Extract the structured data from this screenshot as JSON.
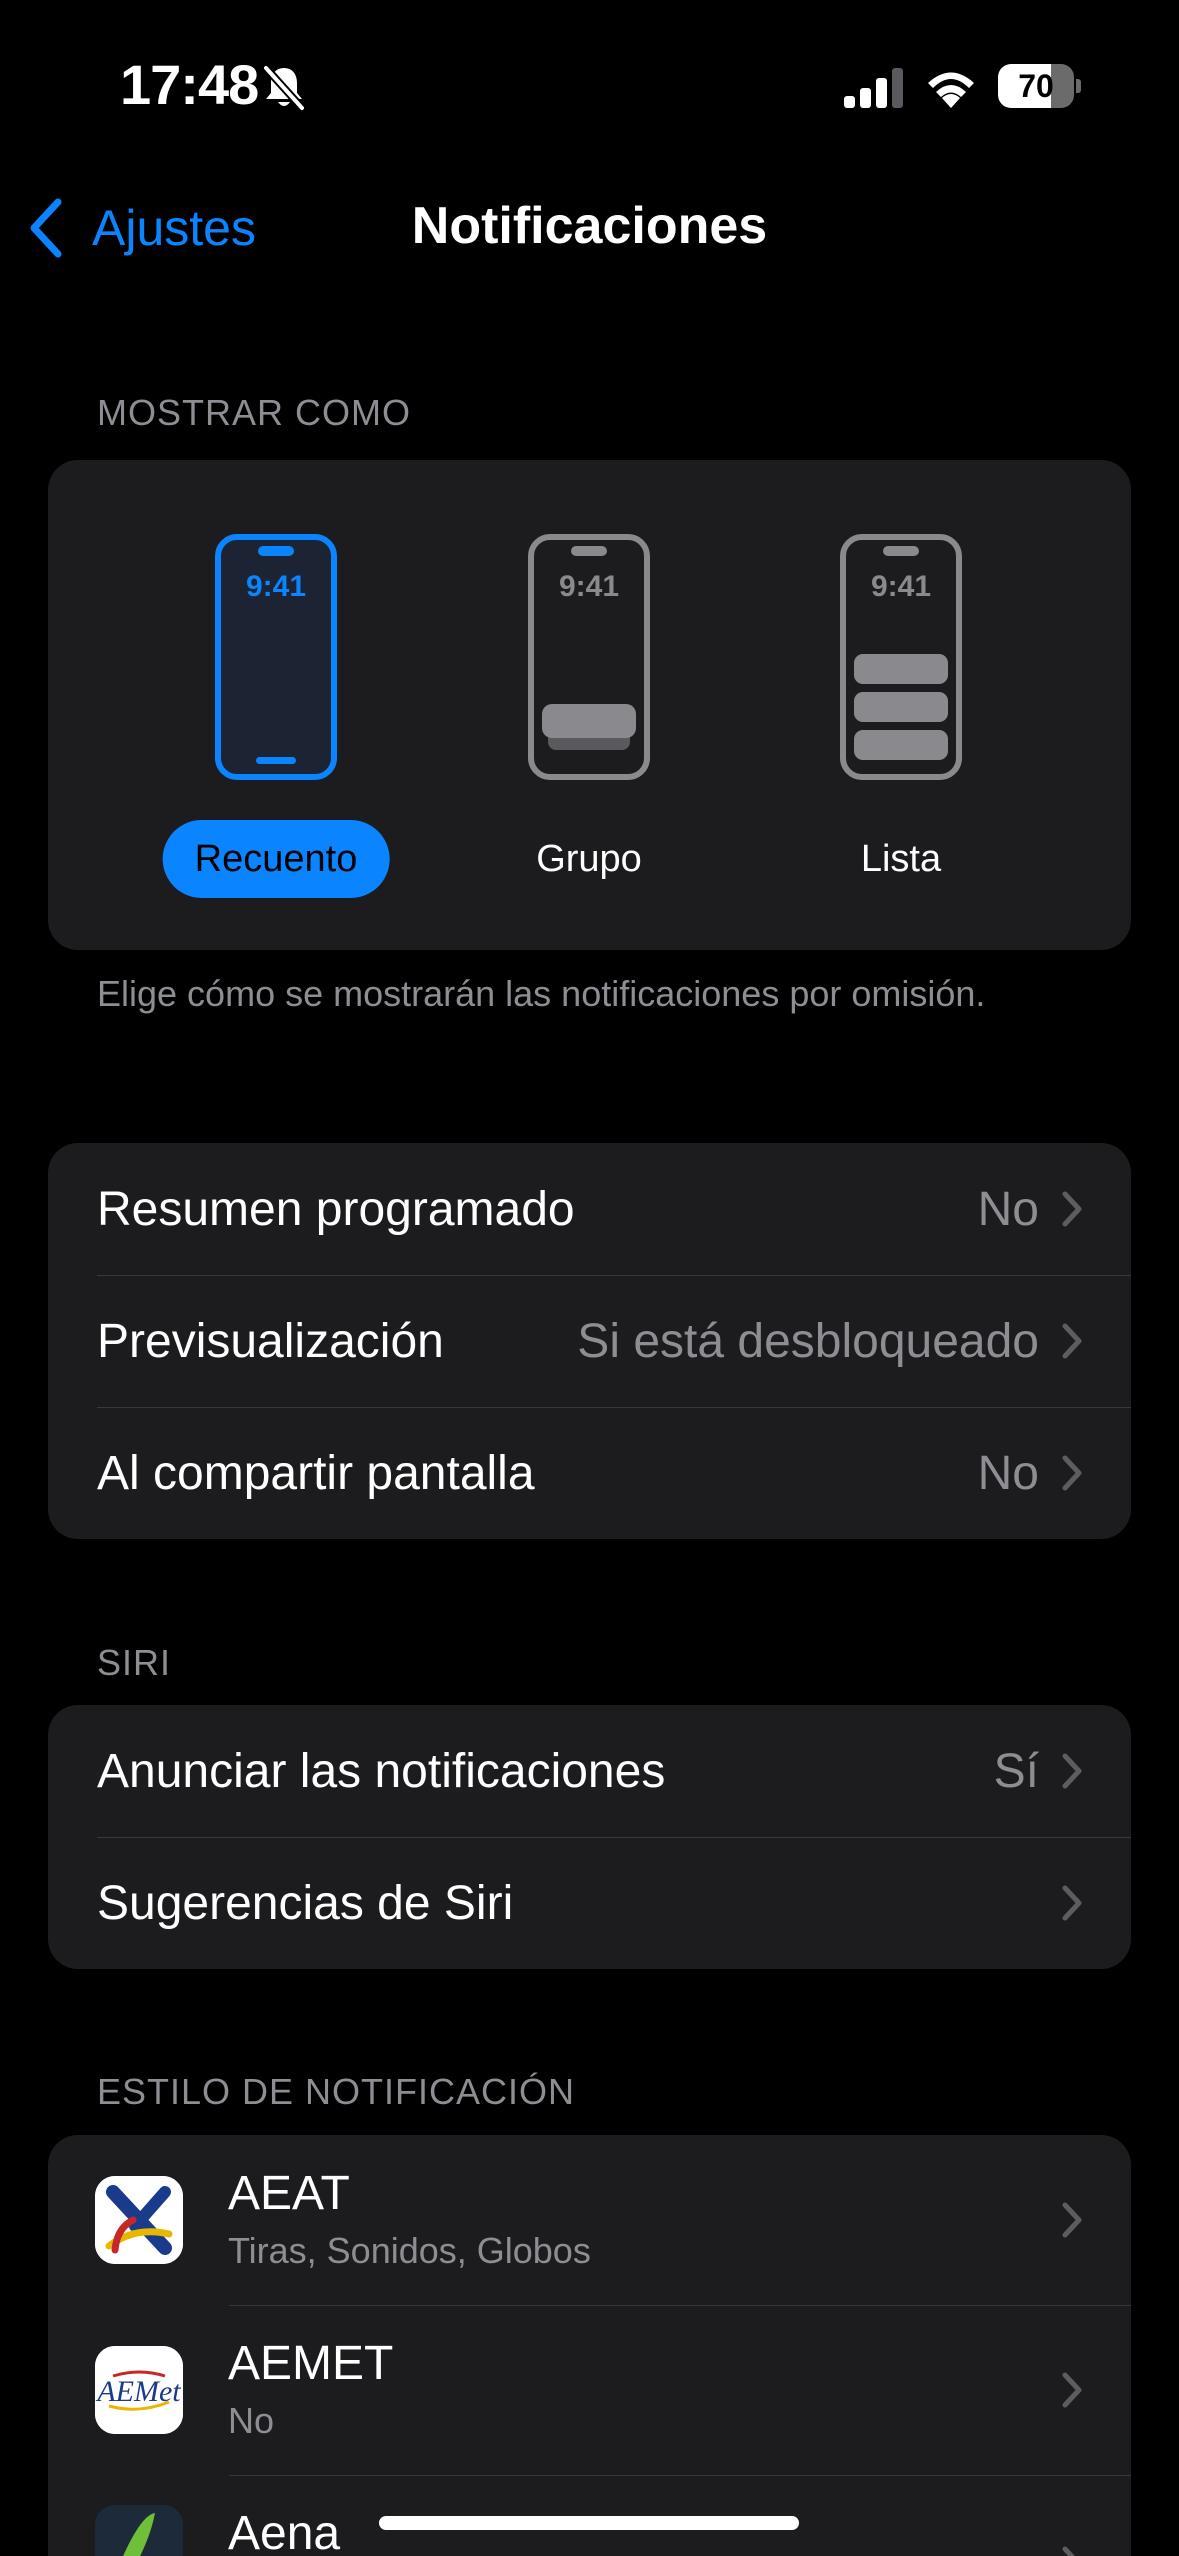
{
  "status_bar": {
    "time": "17:48",
    "battery_level": "70",
    "battery_fraction": 0.7
  },
  "nav": {
    "back_label": "Ajustes",
    "title": "Notificaciones"
  },
  "display_as": {
    "header": "MOSTRAR COMO",
    "phone_time": "9:41",
    "options": [
      {
        "label": "Recuento",
        "selected": true
      },
      {
        "label": "Grupo",
        "selected": false
      },
      {
        "label": "Lista",
        "selected": false
      }
    ],
    "footer": "Elige cómo se mostrarán las notificaciones por omisión."
  },
  "general": {
    "rows": [
      {
        "label": "Resumen programado",
        "value": "No"
      },
      {
        "label": "Previsualización",
        "value": "Si está desbloqueado"
      },
      {
        "label": "Al compartir pantalla",
        "value": "No"
      }
    ]
  },
  "siri": {
    "header": "SIRI",
    "rows": [
      {
        "label": "Anunciar las notificaciones",
        "value": "Sí"
      },
      {
        "label": "Sugerencias de Siri",
        "value": ""
      }
    ]
  },
  "notification_style": {
    "header": "ESTILO DE NOTIFICACIÓN",
    "apps": [
      {
        "name": "AEAT",
        "detail": "Tiras, Sonidos, Globos",
        "icon": "aeat-logo-icon"
      },
      {
        "name": "AEMET",
        "detail": "No",
        "icon": "aemet-logo-icon",
        "icon_text": "AEMet"
      },
      {
        "name": "Aena",
        "detail": "",
        "icon": "aena-logo-icon"
      }
    ]
  },
  "colors": {
    "accent": "#0a84ff",
    "background": "#000000",
    "card": "#1c1c1e",
    "secondary_text": "#8d8d93"
  }
}
